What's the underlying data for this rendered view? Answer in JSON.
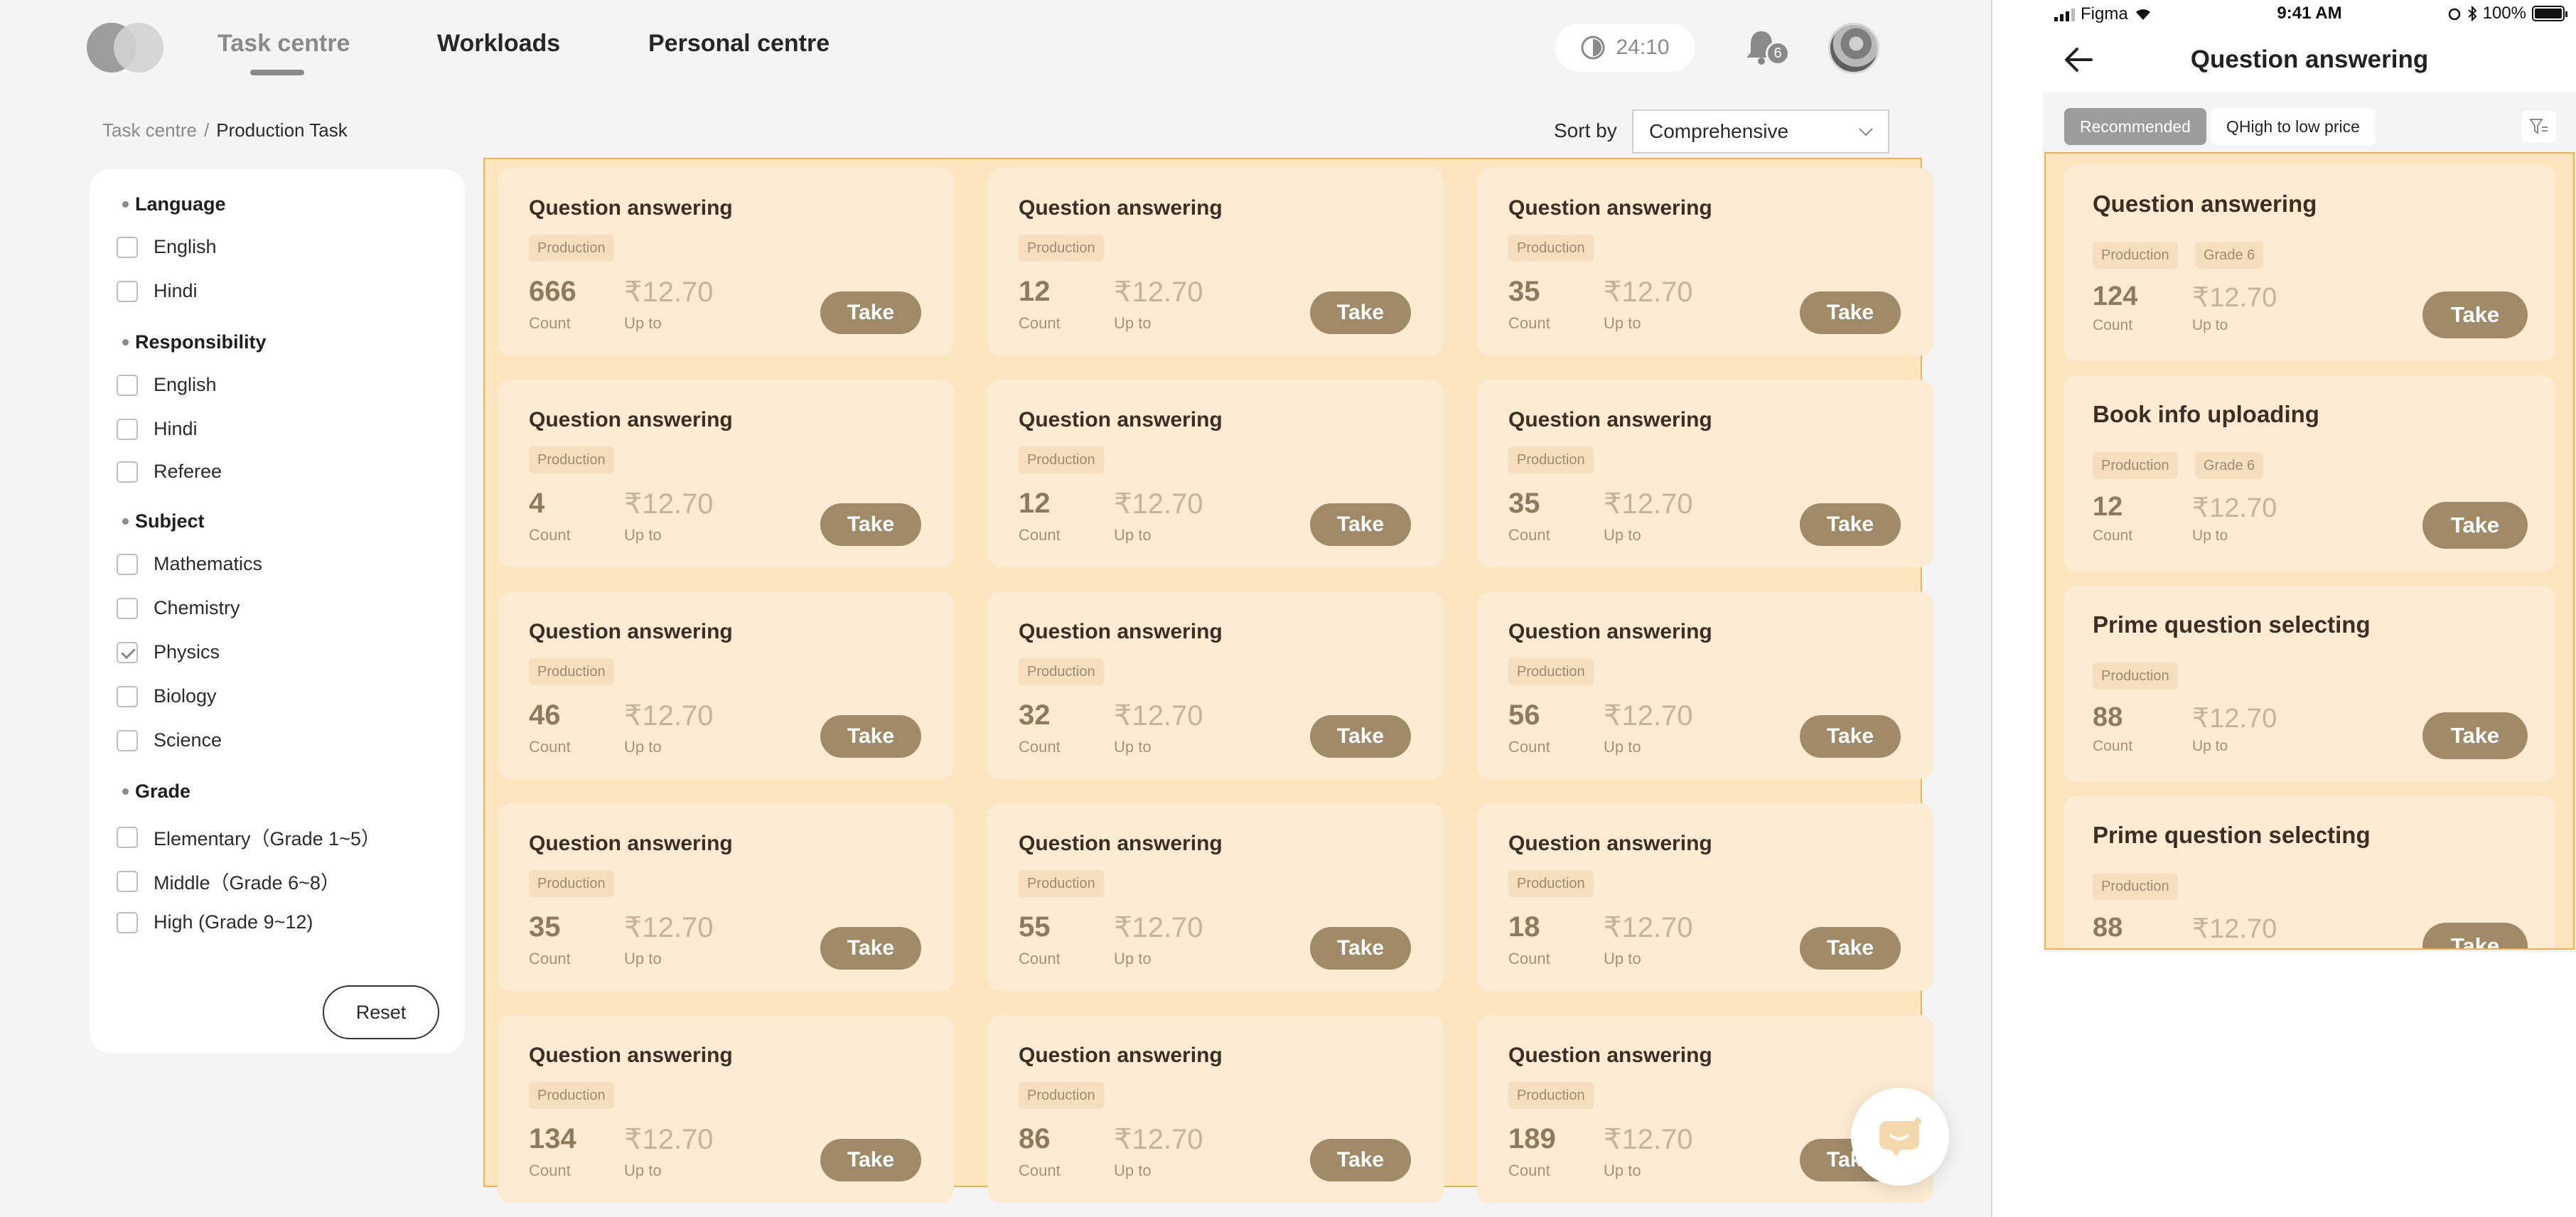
{
  "desktop": {
    "nav": [
      "Task centre",
      "Workloads",
      "Personal centre"
    ],
    "timer": "24:10",
    "notification_count": "6",
    "breadcrumb": [
      "Task centre",
      "Production Task"
    ],
    "breadcrumb_sep": "/",
    "sort_label": "Sort by",
    "sort_value": "Comprehensive",
    "filters": {
      "language": {
        "heading": "Language",
        "options": [
          "English",
          "Hindi"
        ]
      },
      "responsibility": {
        "heading": "Responsibility",
        "options": [
          "English",
          "Hindi",
          "Referee"
        ]
      },
      "subject": {
        "heading": "Subject",
        "options": [
          "Mathematics",
          "Chemistry",
          "Physics",
          "Biology",
          "Science"
        ],
        "checked": "Physics"
      },
      "grade": {
        "heading": "Grade",
        "options": [
          "Elementary（Grade 1~5）",
          "Middle（Grade 6~8）",
          "High (Grade 9~12)"
        ]
      }
    },
    "reset_label": "Reset",
    "cards": [
      {
        "title": "Question answering",
        "tag": "Production",
        "count": "666",
        "price": "₹12.70"
      },
      {
        "title": "Question answering",
        "tag": "Production",
        "count": "12",
        "price": "₹12.70"
      },
      {
        "title": "Question answering",
        "tag": "Production",
        "count": "35",
        "price": "₹12.70"
      },
      {
        "title": "Question answering",
        "tag": "Production",
        "count": "4",
        "price": "₹12.70"
      },
      {
        "title": "Question answering",
        "tag": "Production",
        "count": "12",
        "price": "₹12.70"
      },
      {
        "title": "Question answering",
        "tag": "Production",
        "count": "35",
        "price": "₹12.70"
      },
      {
        "title": "Question answering",
        "tag": "Production",
        "count": "46",
        "price": "₹12.70"
      },
      {
        "title": "Question answering",
        "tag": "Production",
        "count": "32",
        "price": "₹12.70"
      },
      {
        "title": "Question answering",
        "tag": "Production",
        "count": "56",
        "price": "₹12.70"
      },
      {
        "title": "Question answering",
        "tag": "Production",
        "count": "35",
        "price": "₹12.70"
      },
      {
        "title": "Question answering",
        "tag": "Production",
        "count": "55",
        "price": "₹12.70"
      },
      {
        "title": "Question answering",
        "tag": "Production",
        "count": "18",
        "price": "₹12.70"
      },
      {
        "title": "Question answering",
        "tag": "Production",
        "count": "134",
        "price": "₹12.70"
      },
      {
        "title": "Question answering",
        "tag": "Production",
        "count": "86",
        "price": "₹12.70"
      },
      {
        "title": "Question answering",
        "tag": "Production",
        "count": "189",
        "price": "₹12.70"
      }
    ],
    "labels": {
      "count": "Count",
      "price": "Up to",
      "take": "Take"
    }
  },
  "mobile": {
    "status": {
      "carrier": "Figma",
      "time": "9:41 AM",
      "battery": "100%"
    },
    "title": "Question answering",
    "tabs": [
      "Recommended",
      "QHigh to low price"
    ],
    "cards": [
      {
        "title": "Question answering",
        "tags": [
          "Production",
          "Grade 6"
        ],
        "count": "124",
        "price": "₹12.70"
      },
      {
        "title": "Book info uploading",
        "tags": [
          "Production",
          "Grade 6"
        ],
        "count": "12",
        "price": "₹12.70"
      },
      {
        "title": "Prime question selecting",
        "tags": [
          "Production"
        ],
        "count": "88",
        "price": "₹12.70"
      },
      {
        "title": "Prime question selecting",
        "tags": [
          "Production"
        ],
        "count": "88",
        "price": "₹12.70"
      }
    ],
    "labels": {
      "count": "Count",
      "price": "Up to",
      "take": "Take"
    }
  },
  "icons": {
    "logo": "logo-circles",
    "timer": "clock-icon",
    "bell": "bell-icon",
    "sort": "chevron-down-icon",
    "back": "arrow-left-icon",
    "filter": "filter-icon",
    "help": "chat-bot-icon"
  },
  "colors": {
    "accent": "#a08a68",
    "highlight_border": "#f0b14a",
    "card_bg": "#fdecd3",
    "area_bg": "#fde5c0"
  }
}
